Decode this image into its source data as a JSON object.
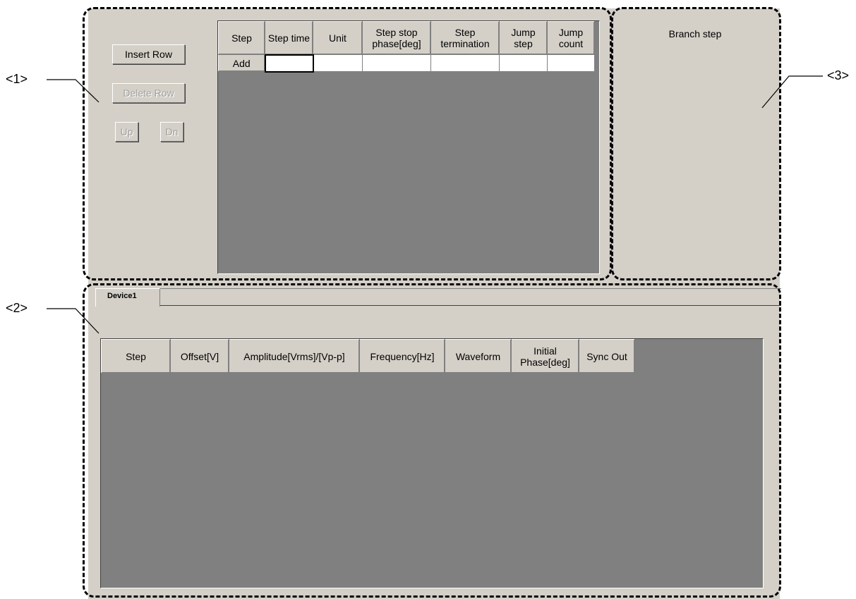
{
  "callouts": {
    "c1": "<1>",
    "c2": "<2>",
    "c3": "<3>"
  },
  "step_panel": {
    "buttons": {
      "insert_row": "Insert Row",
      "delete_row": "Delete Row",
      "up": "Up",
      "dn": "Dn"
    },
    "columns": {
      "step": "Step",
      "step_time": "Step time",
      "unit": "Unit",
      "step_stop_phase": "Step stop phase[deg]",
      "step_termination": "Step termination",
      "jump_step": "Jump step",
      "jump_count": "Jump count"
    },
    "add_row_label": "Add"
  },
  "branch_panel": {
    "title": "Branch step"
  },
  "device_panel": {
    "tab": "Device1",
    "columns": {
      "step": "Step",
      "offset": "Offset[V]",
      "amplitude": "Amplitude[Vrms]/[Vp-p]",
      "frequency": "Frequency[Hz]",
      "waveform": "Waveform",
      "initial_phase": "Initial Phase[deg]",
      "sync_out": "Sync Out"
    }
  }
}
